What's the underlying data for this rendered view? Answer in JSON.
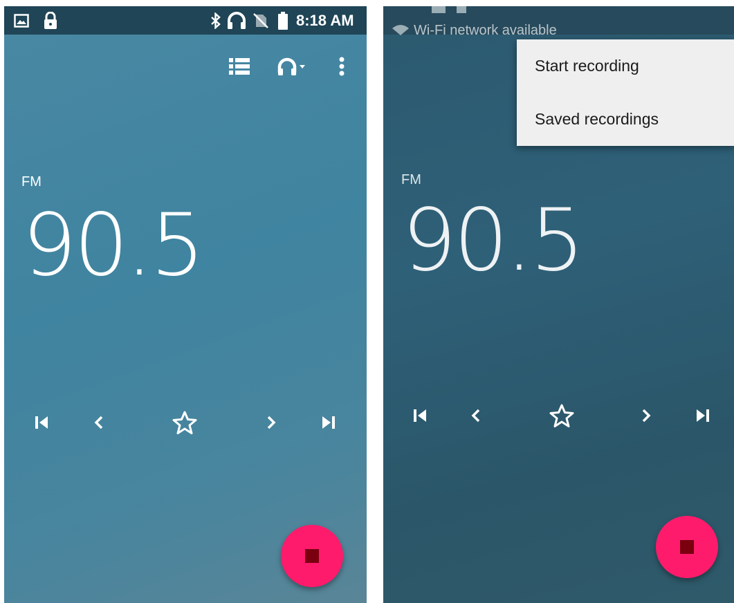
{
  "left_screen": {
    "status_bar": {
      "left_icons": [
        "image-icon",
        "lock-icon"
      ],
      "right_icons": [
        "bluetooth-icon",
        "headphones-icon",
        "no-sim-icon",
        "battery-icon"
      ],
      "time": "8:18 AM"
    },
    "toolbar": {
      "icons": [
        "station-list-icon",
        "headphones-output-icon",
        "more-vert-icon"
      ]
    },
    "band": "FM",
    "frequency": "90.5",
    "controls": [
      "seek-back-icon",
      "tune-down-icon",
      "favorite-star-icon",
      "tune-up-icon",
      "seek-forward-icon"
    ],
    "fab": {
      "icon": "stop-icon",
      "color": "#ff1b6b"
    }
  },
  "right_screen": {
    "notification_ghost": "Wi-Fi network available",
    "menu": {
      "items": [
        {
          "label": "Start recording"
        },
        {
          "label": "Saved recordings"
        }
      ]
    },
    "band": "FM",
    "frequency": "90.5",
    "controls": [
      "seek-back-icon",
      "tune-down-icon",
      "favorite-star-icon",
      "tune-up-icon",
      "seek-forward-icon"
    ],
    "fab": {
      "icon": "stop-icon",
      "color": "#ff1b6b"
    }
  },
  "colors": {
    "accent": "#ff1b6b",
    "left_bg": "#4385a1",
    "right_bg": "#2c5a6f",
    "status_bar": "#1f4556"
  }
}
